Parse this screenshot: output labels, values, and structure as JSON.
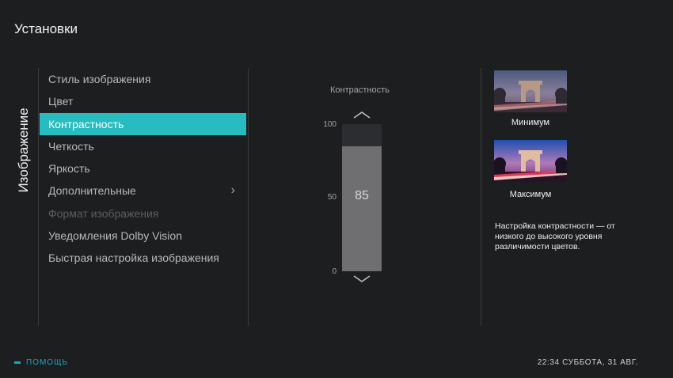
{
  "header": {
    "title": "Установки"
  },
  "category": {
    "label": "Изображение"
  },
  "menu": {
    "items": [
      {
        "label": "Стиль изображения",
        "state": "normal"
      },
      {
        "label": "Цвет",
        "state": "normal"
      },
      {
        "label": "Контрастность",
        "state": "selected"
      },
      {
        "label": "Четкость",
        "state": "normal"
      },
      {
        "label": "Яркость",
        "state": "normal"
      },
      {
        "label": "Дополнительные",
        "state": "normal",
        "has_submenu": true
      },
      {
        "label": "Формат изображения",
        "state": "disabled"
      },
      {
        "label": "Уведомления Dolby Vision",
        "state": "normal"
      },
      {
        "label": "Быстрая настройка изображения",
        "state": "normal"
      }
    ],
    "submenu_icon": "chevron-right-icon"
  },
  "slider": {
    "title": "Контрастность",
    "max_label": "100",
    "mid_label": "50",
    "min_label": "0",
    "max": 100,
    "value": 85,
    "value_label": "85"
  },
  "preview": {
    "min_caption": "Минимум",
    "max_caption": "Максимум",
    "description": "Настройка контрастности — от низкого до высокого уровня различимости цветов."
  },
  "footer": {
    "help_label": "ПОМОЩЬ",
    "clock": "22:34 СУББОТА, 31 АВГ."
  },
  "colors": {
    "accent": "#27bcbf",
    "help": "#1ba6c9",
    "background": "#1d1e20"
  }
}
